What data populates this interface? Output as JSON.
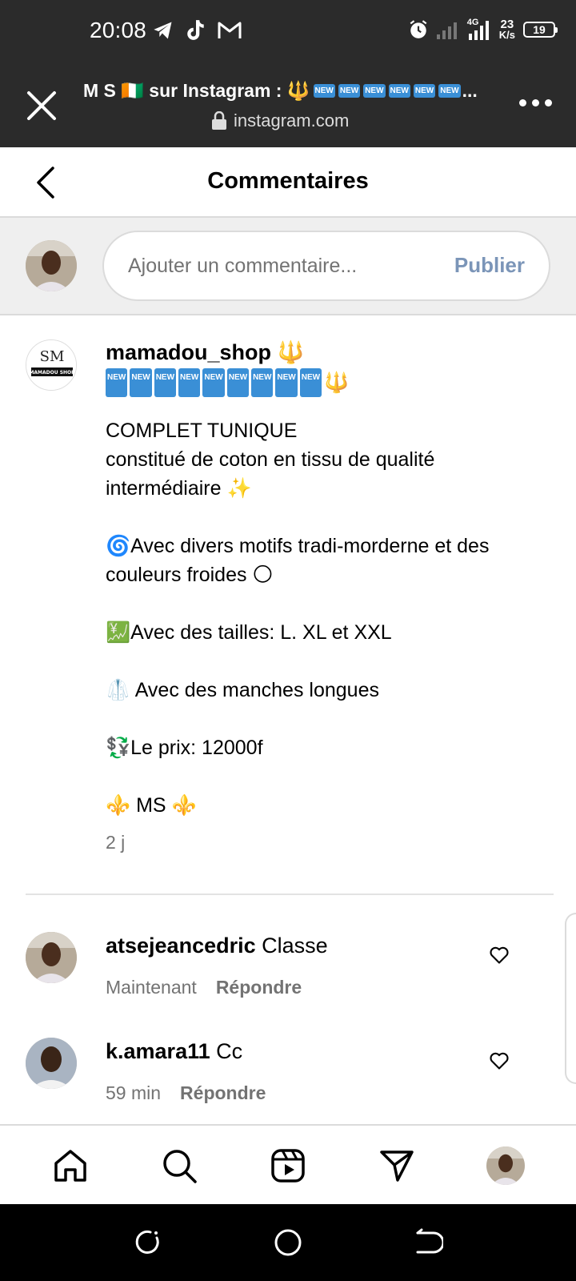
{
  "status_bar": {
    "time": "20:08",
    "network_type": "4G",
    "speed_value": "23",
    "speed_unit": "K/s",
    "battery": "19",
    "app_icons": [
      "telegram-icon",
      "tiktok-icon",
      "gmail-icon"
    ]
  },
  "browser": {
    "page_title": "M S 🇨🇮 sur Instagram : 🔱",
    "title_badge": "NEW",
    "title_ellipsis": "...",
    "domain": "instagram.com"
  },
  "header": {
    "title": "Commentaires"
  },
  "composer": {
    "placeholder": "Ajouter un commentaire...",
    "publish_label": "Publier"
  },
  "caption": {
    "username": "mamadou_shop 🔱",
    "badge_label": "NEW",
    "badge_row_suffix": "🔱",
    "lines": [
      "COMPLET TUNIQUE",
      "constitué de coton en tissu de qualité intermédiaire ✨",
      "",
      "🌀Avec divers motifs tradi-morderne et des couleurs froides 🌕",
      "",
      "💹Avec des tailles: L. XL et XXL",
      "",
      "🥼 Avec des manches longues",
      "",
      "💱Le prix: 12000f",
      "",
      "⚜️ MS ⚜️"
    ],
    "time": "2 j"
  },
  "comments": [
    {
      "username": "atsejeancedric",
      "text": "Classe",
      "time": "Maintenant",
      "reply_label": "Répondre"
    },
    {
      "username": "k.amara11",
      "text": "Cc",
      "time": "59 min",
      "reply_label": "Répondre"
    }
  ],
  "colors": {
    "chrome_bg": "#2b2b2b",
    "publish": "#7b95b8",
    "badge": "#3a8fd6",
    "muted": "#737373"
  }
}
